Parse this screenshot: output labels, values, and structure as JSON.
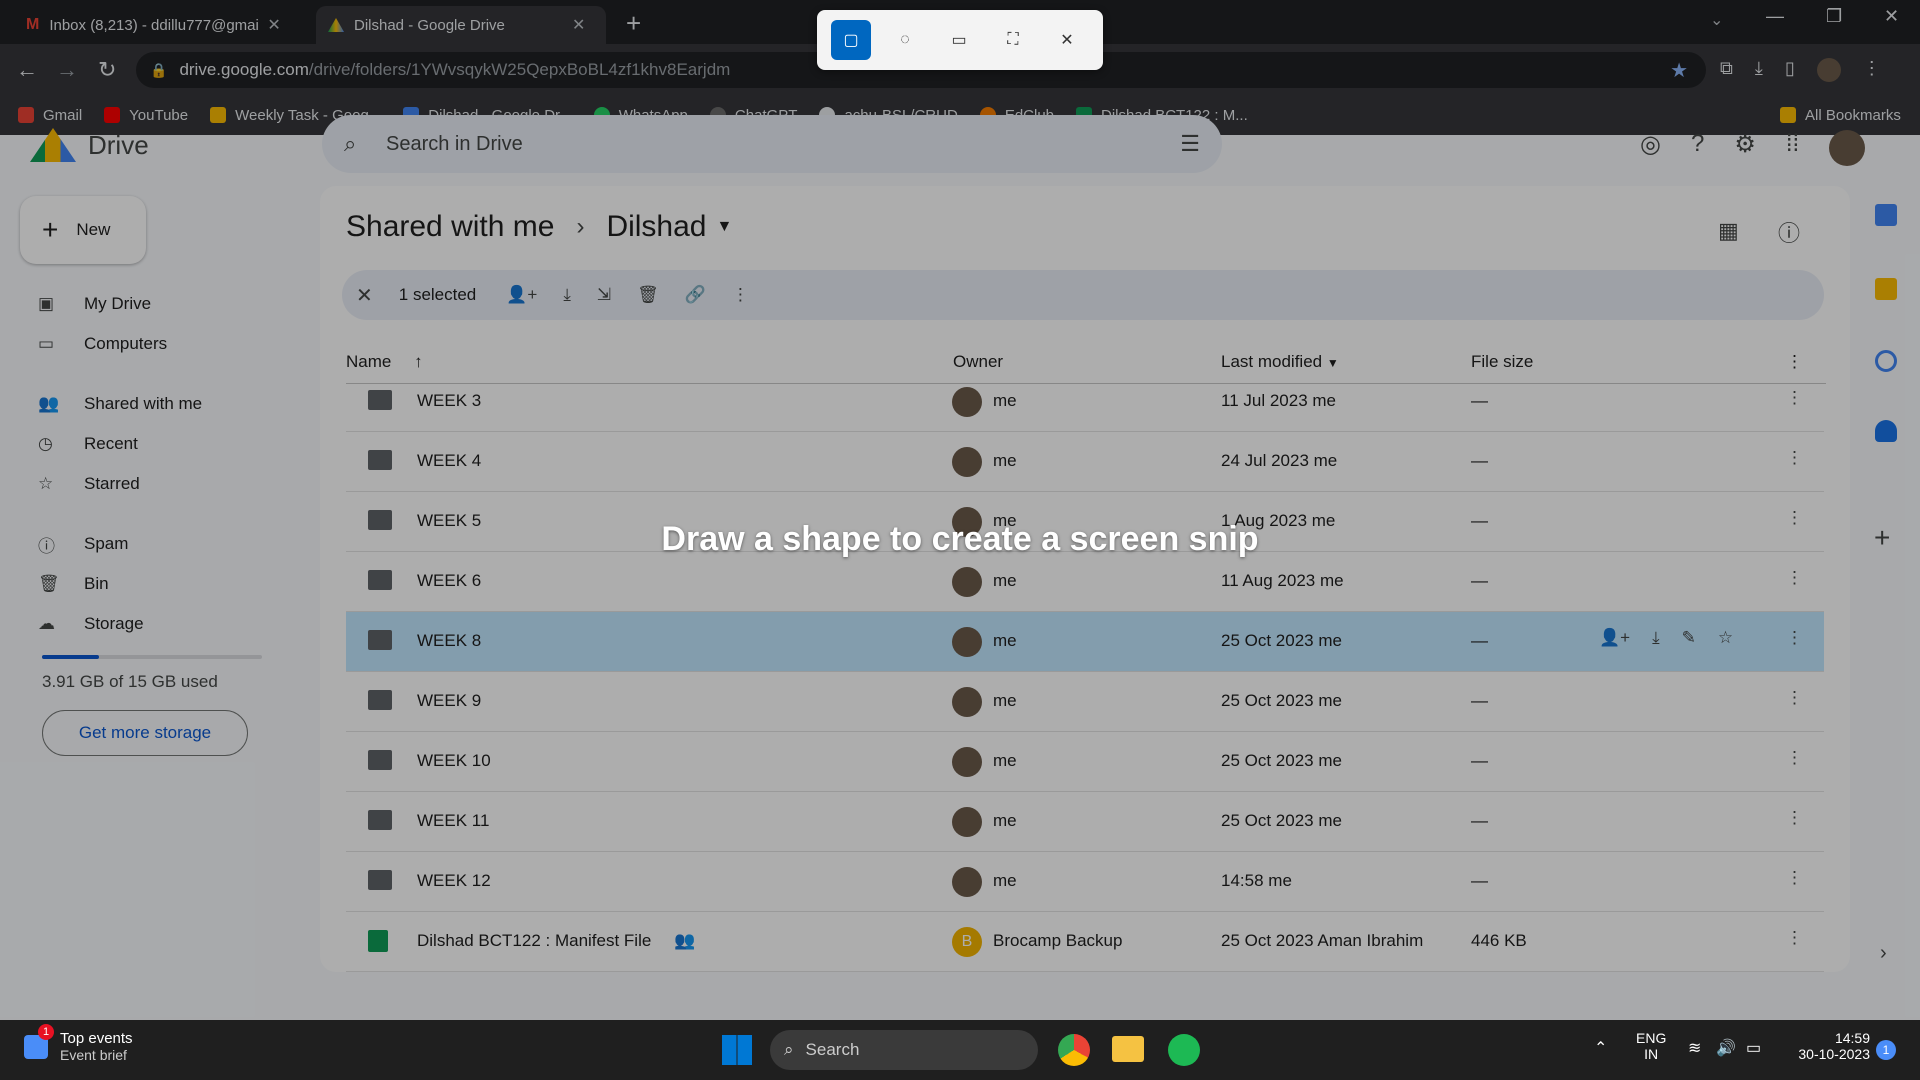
{
  "browser": {
    "tabs": [
      {
        "title": "Inbox (8,213) - ddillu777@gmail",
        "active": false
      },
      {
        "title": "Dilshad - Google Drive",
        "active": true
      }
    ],
    "url_host": "drive.google.com",
    "url_path": "/drive/folders/1YWvsqykW25QepxBoBL4zf1khv8Earjdm",
    "bookmarks": [
      "Gmail",
      "YouTube",
      "Weekly Task - Goog...",
      "Dilshad - Google Dr...",
      "WhatsApp",
      "ChatGPT",
      "achu-BSL/CRUD",
      "EdClub",
      "Dilshad BCT122 : M..."
    ],
    "all_bookmarks": "All Bookmarks"
  },
  "drive": {
    "logo_text": "Drive",
    "search_placeholder": "Search in Drive",
    "new_label": "New",
    "nav": [
      {
        "label": "My Drive",
        "icon": "my-drive-icon"
      },
      {
        "label": "Computers",
        "icon": "computers-icon"
      },
      {
        "label": "Shared with me",
        "icon": "shared-icon"
      },
      {
        "label": "Recent",
        "icon": "clock-icon"
      },
      {
        "label": "Starred",
        "icon": "star-icon"
      },
      {
        "label": "Spam",
        "icon": "spam-icon"
      },
      {
        "label": "Bin",
        "icon": "bin-icon"
      },
      {
        "label": "Storage",
        "icon": "cloud-icon"
      }
    ],
    "storage_text": "3.91 GB of 15 GB used",
    "storage_used_fraction": 0.26,
    "get_more": "Get more storage",
    "breadcrumb_parent": "Shared with me",
    "breadcrumb_current": "Dilshad",
    "selected_label": "1 selected",
    "columns": {
      "name": "Name",
      "owner": "Owner",
      "modified": "Last modified",
      "size": "File size"
    },
    "rows": [
      {
        "name": "WEEK 3",
        "owner": "me",
        "modified": "11 Jul 2023",
        "modifier": "me",
        "size": "—"
      },
      {
        "name": "WEEK 4",
        "owner": "me",
        "modified": "24 Jul 2023",
        "modifier": "me",
        "size": "—"
      },
      {
        "name": "WEEK 5",
        "owner": "me",
        "modified": "1 Aug 2023",
        "modifier": "me",
        "size": "—"
      },
      {
        "name": "WEEK 6",
        "owner": "me",
        "modified": "11 Aug 2023",
        "modifier": "me",
        "size": "—"
      },
      {
        "name": "WEEK 8",
        "owner": "me",
        "modified": "25 Oct 2023",
        "modifier": "me",
        "size": "—",
        "selected": true
      },
      {
        "name": "WEEK 9",
        "owner": "me",
        "modified": "25 Oct 2023",
        "modifier": "me",
        "size": "—"
      },
      {
        "name": "WEEK 10",
        "owner": "me",
        "modified": "25 Oct 2023",
        "modifier": "me",
        "size": "—"
      },
      {
        "name": "WEEK 11",
        "owner": "me",
        "modified": "25 Oct 2023",
        "modifier": "me",
        "size": "—"
      },
      {
        "name": "WEEK 12",
        "owner": "me",
        "modified": "14:58",
        "modifier": "me",
        "size": "—"
      },
      {
        "name": "Dilshad BCT122 : Manifest File",
        "owner": "Brocamp Backup",
        "modified": "25 Oct 2023",
        "modifier": "Aman Ibrahim",
        "size": "446 KB",
        "type": "sheet"
      }
    ]
  },
  "snip": {
    "message": "Draw a shape to create a screen snip"
  },
  "taskbar": {
    "news_title": "Top events",
    "news_sub": "Event brief",
    "news_badge": "1",
    "search": "Search",
    "lang1": "ENG",
    "lang2": "IN",
    "time": "14:59",
    "date": "30-10-2023",
    "notif": "1"
  },
  "colors": {
    "accent": "#0b57d0",
    "selected_row": "#c2e7ff",
    "sheet_green": "#0f9d58"
  }
}
